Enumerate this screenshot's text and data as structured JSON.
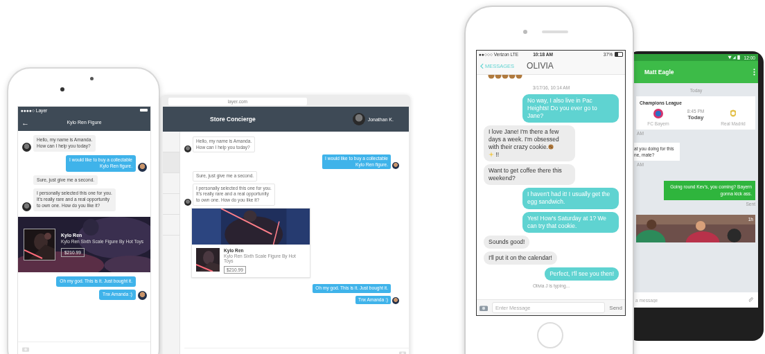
{
  "store_phone": {
    "carrier": "●●●●○ Layer",
    "back": "←",
    "title": "Kylo Ren Figure",
    "messages": [
      {
        "kind": "in",
        "text": "Hello, my name is Amanda.\nHow can I help you today?",
        "avatar": true
      },
      {
        "kind": "out",
        "text": "I would like to buy a collectable\nKylo Ren figure.",
        "avatar": true
      },
      {
        "kind": "in",
        "text": "Sure, just give me a second.",
        "avatar": false
      },
      {
        "kind": "in",
        "text": "I personally selected this one for you.\nIt's really rare and a real opportunity\nto own one. How do you like it?",
        "avatar": true
      }
    ],
    "product": {
      "kind": "picture",
      "name": "Kylo Ren",
      "description": "Kylo Ren Sixth Scale Figure By Hot Toys",
      "price": "$210.99"
    },
    "messages_after": [
      {
        "kind": "out",
        "text": "Oh my god. This is it. Just bought it.",
        "avatar": false
      },
      {
        "kind": "out",
        "text": "Tnx Amanda :)",
        "avatar": true
      }
    ]
  },
  "store_web": {
    "url": "layer.com",
    "title": "Store Concierge",
    "user": "Jonathan K.",
    "messages": [
      {
        "kind": "in",
        "text": "Hello, my name is Amanda.\nHow can I help you today?",
        "avatar": true
      },
      {
        "kind": "out",
        "text": "I would like to buy a collectable\nKylo Ren figure.",
        "avatar": true
      },
      {
        "kind": "in",
        "text": "Sure, just give me a second.",
        "avatar": false
      },
      {
        "kind": "in",
        "text": "I personally selected this one for you.\nIt's really rare and a real opportunity\nto own one. How do you like it?",
        "avatar": true
      }
    ],
    "product": {
      "kind": "picture",
      "name": "Kylo Ren",
      "description": "Kylo Ren Sixth Scale Figure By Hot Toys",
      "price": "$210.99"
    },
    "messages_after": [
      {
        "kind": "out",
        "text": "Oh my god. This is it. Just bought it.",
        "avatar": false
      },
      {
        "kind": "out",
        "text": "Tnx Amanda :)",
        "avatar": true
      }
    ]
  },
  "olivia_phone": {
    "carrier": "●●○○○ Verizon LTE",
    "time": "10:18 AM",
    "battery": "37%",
    "back": "MESSAGES",
    "title": "OLIVIA",
    "timestamp": "3/17/16, 10:14 AM",
    "messages": [
      {
        "kind": "out",
        "text": "No way, I also live in Pac Heights! Do you ever go to Jane?"
      },
      {
        "kind": "in",
        "text": "I love Jane! I'm there a few days a week. I'm obsessed with their crazy cookie.",
        "suffix": "!!"
      },
      {
        "kind": "in",
        "text": "Want to get coffee there this weekend?"
      },
      {
        "kind": "out",
        "text": "I haven't had it! I usually get the egg sandwich."
      },
      {
        "kind": "out",
        "text": "Yes! How's Saturday at 1? We can try that cookie."
      },
      {
        "kind": "in",
        "text": "Sounds good!"
      },
      {
        "kind": "in",
        "text": "I'll put it on the calendar!"
      },
      {
        "kind": "out",
        "text": "Perfect, I'll see you then!"
      }
    ],
    "typing": "Olivia J is typing...",
    "placeholder": "Enter Message",
    "send": "Send"
  },
  "android_phone": {
    "time": "12:00",
    "title": "Matt Eagle",
    "day": "Today",
    "card": {
      "title": "Champions League",
      "time": "8:45 PM",
      "day": "Today",
      "home": "FC Bayern",
      "away": "Real Madrid"
    },
    "card_time": "AM",
    "incoming": [
      "at you doing for this",
      "ne, mate?"
    ],
    "incoming_time": "AM",
    "outgoing": "Going round Kev's, you coming? Bayern gonna kick ass.",
    "outgoing_status": "Sent",
    "photo": {
      "kind": "picture",
      "age": "1h"
    },
    "placeholder": "a message"
  }
}
